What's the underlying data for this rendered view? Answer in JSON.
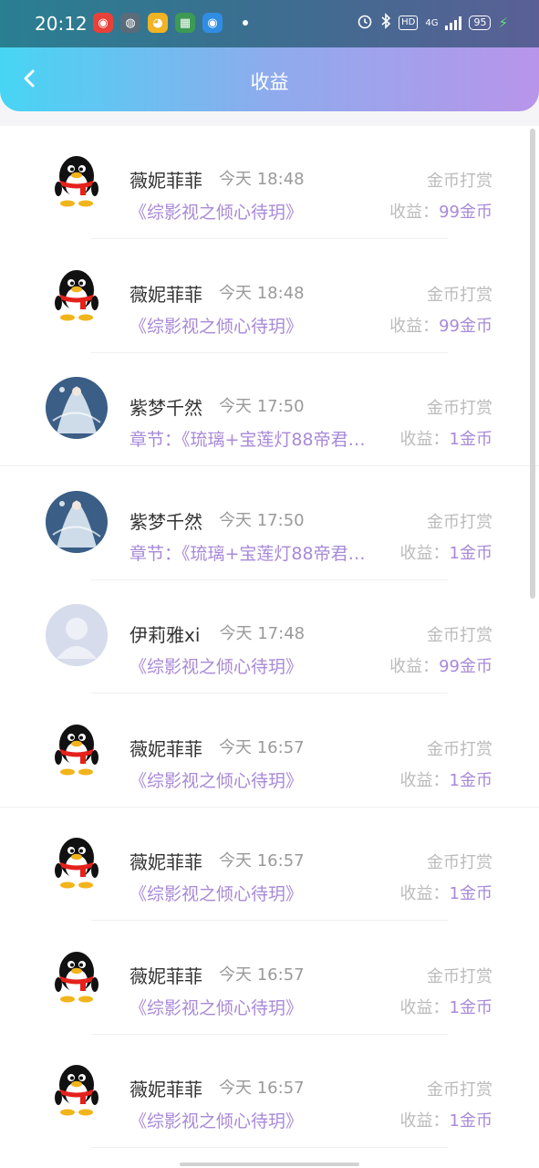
{
  "status_bar": {
    "time": "20:12",
    "hd": "HD",
    "network": "4G",
    "battery": "95",
    "apps": [
      {
        "icon": "netease-music-icon",
        "color": "#e8413a",
        "glyph": "◉"
      },
      {
        "icon": "wechat-icon",
        "color": "#5a6b7a",
        "glyph": "◍"
      },
      {
        "icon": "weibo-icon",
        "color": "#f0b324",
        "glyph": "◕"
      },
      {
        "icon": "android-icon",
        "color": "#3c9a55",
        "glyph": "▦"
      },
      {
        "icon": "blue-app-icon",
        "color": "#2f8de4",
        "glyph": "◉"
      }
    ]
  },
  "header": {
    "title": "收益"
  },
  "records": [
    {
      "name": "薇妮菲菲",
      "time": "今天 18:48",
      "title": "《综影视之倾心待玥》",
      "type": "金币打赏",
      "income_label": "收益：",
      "income_value": "99金币",
      "avatar": "qq"
    },
    {
      "name": "薇妮菲菲",
      "time": "今天 18:48",
      "title": "《综影视之倾心待玥》",
      "type": "金币打赏",
      "income_label": "收益：",
      "income_value": "99金币",
      "avatar": "qq"
    },
    {
      "name": "紫梦千然",
      "time": "今天 17:50",
      "title": "章节：《琉璃+宝莲灯88帝君…",
      "type": "金币打赏",
      "income_label": "收益：",
      "income_value": "1金币",
      "avatar": "fairy"
    },
    {
      "name": "紫梦千然",
      "time": "今天 17:50",
      "title": "章节：《琉璃+宝莲灯88帝君…",
      "type": "金币打赏",
      "income_label": "收益：",
      "income_value": "1金币",
      "avatar": "fairy"
    },
    {
      "name": "伊莉雅xi",
      "time": "今天 17:48",
      "title": "《综影视之倾心待玥》",
      "type": "金币打赏",
      "income_label": "收益：",
      "income_value": "99金币",
      "avatar": "default"
    },
    {
      "name": "薇妮菲菲",
      "time": "今天 16:57",
      "title": "《综影视之倾心待玥》",
      "type": "金币打赏",
      "income_label": "收益：",
      "income_value": "1金币",
      "avatar": "qq"
    },
    {
      "name": "薇妮菲菲",
      "time": "今天 16:57",
      "title": "《综影视之倾心待玥》",
      "type": "金币打赏",
      "income_label": "收益：",
      "income_value": "1金币",
      "avatar": "qq"
    },
    {
      "name": "薇妮菲菲",
      "time": "今天 16:57",
      "title": "《综影视之倾心待玥》",
      "type": "金币打赏",
      "income_label": "收益：",
      "income_value": "1金币",
      "avatar": "qq"
    },
    {
      "name": "薇妮菲菲",
      "time": "今天 16:57",
      "title": "《综影视之倾心待玥》",
      "type": "金币打赏",
      "income_label": "收益：",
      "income_value": "1金币",
      "avatar": "qq"
    }
  ]
}
